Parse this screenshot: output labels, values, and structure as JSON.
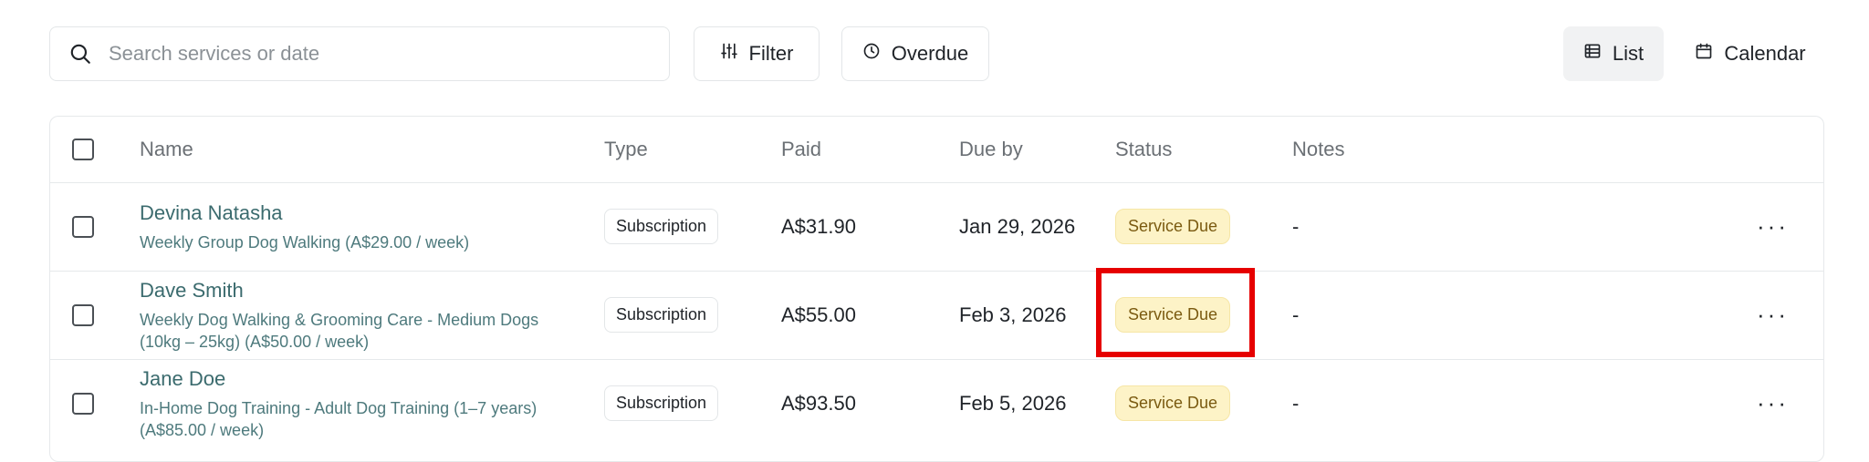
{
  "toolbar": {
    "search_placeholder": "Search services or date",
    "filter_label": "Filter",
    "overdue_label": "Overdue",
    "list_label": "List",
    "calendar_label": "Calendar"
  },
  "table": {
    "headers": {
      "name": "Name",
      "type": "Type",
      "paid": "Paid",
      "due_by": "Due by",
      "status": "Status",
      "notes": "Notes"
    },
    "rows": [
      {
        "name": "Devina Natasha",
        "description": "Weekly Group Dog Walking (A$29.00 / week)",
        "type": "Subscription",
        "paid": "A$31.90",
        "due_by": "Jan 29, 2026",
        "status": "Service Due",
        "notes": "-",
        "more": "···"
      },
      {
        "name": "Dave Smith",
        "description": "Weekly Dog Walking & Grooming Care - Medium Dogs (10kg – 25kg) (A$50.00 / week)",
        "type": "Subscription",
        "paid": "A$55.00",
        "due_by": "Feb 3, 2026",
        "status": "Service Due",
        "notes": "-",
        "more": "···"
      },
      {
        "name": "Jane Doe",
        "description": "In-Home Dog Training - Adult Dog Training (1–7 years) (A$85.00 / week)",
        "type": "Subscription",
        "paid": "A$93.50",
        "due_by": "Feb 5, 2026",
        "status": "Service Due",
        "notes": "-",
        "more": "···"
      }
    ]
  },
  "colors": {
    "accent_name": "#3b6b6e",
    "status_bg": "#fdf3c7",
    "status_text": "#7a5a10",
    "highlight": "#e60000"
  },
  "icons": [
    "search-icon",
    "sliders-icon",
    "clock-icon",
    "list-icon",
    "calendar-icon",
    "more-icon"
  ]
}
